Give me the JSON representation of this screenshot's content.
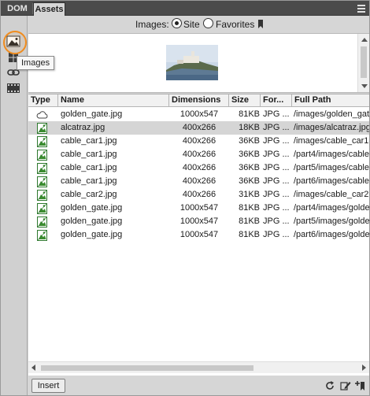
{
  "tabs": [
    {
      "label": "DOM",
      "active": false
    },
    {
      "label": "Assets",
      "active": true
    }
  ],
  "tooltip": {
    "text": "Images"
  },
  "left_toolbar": {
    "icons": [
      "images-icon",
      "colors-icon",
      "urls-icon",
      "media-icon"
    ],
    "highlight_color": "#f08c1e"
  },
  "source": {
    "label": "Images:",
    "options": [
      {
        "label": "Site",
        "selected": true
      },
      {
        "label": "Favorites",
        "selected": false
      }
    ]
  },
  "table": {
    "columns": [
      "Type",
      "Name",
      "Dimensions",
      "Size",
      "For...",
      "Full Path"
    ],
    "rows": [
      {
        "type": "cloud",
        "name": "golden_gate.jpg",
        "dimensions": "1000x547",
        "size": "81KB",
        "format": "JPG ...",
        "path": "/images/golden_gat",
        "selected": false
      },
      {
        "type": "image",
        "name": "alcatraz.jpg",
        "dimensions": "400x266",
        "size": "18KB",
        "format": "JPG ...",
        "path": "/images/alcatraz.jpg",
        "selected": true
      },
      {
        "type": "image",
        "name": "cable_car1.jpg",
        "dimensions": "400x266",
        "size": "36KB",
        "format": "JPG ...",
        "path": "/images/cable_car1.",
        "selected": false
      },
      {
        "type": "image",
        "name": "cable_car1.jpg",
        "dimensions": "400x266",
        "size": "36KB",
        "format": "JPG ...",
        "path": "/part4/images/cable",
        "selected": false
      },
      {
        "type": "image",
        "name": "cable_car1.jpg",
        "dimensions": "400x266",
        "size": "36KB",
        "format": "JPG ...",
        "path": "/part5/images/cable",
        "selected": false
      },
      {
        "type": "image",
        "name": "cable_car1.jpg",
        "dimensions": "400x266",
        "size": "36KB",
        "format": "JPG ...",
        "path": "/part6/images/cable",
        "selected": false
      },
      {
        "type": "image",
        "name": "cable_car2.jpg",
        "dimensions": "400x266",
        "size": "31KB",
        "format": "JPG ...",
        "path": "/images/cable_car2.",
        "selected": false
      },
      {
        "type": "image",
        "name": "golden_gate.jpg",
        "dimensions": "1000x547",
        "size": "81KB",
        "format": "JPG ...",
        "path": "/part4/images/golde",
        "selected": false
      },
      {
        "type": "image",
        "name": "golden_gate.jpg",
        "dimensions": "1000x547",
        "size": "81KB",
        "format": "JPG ...",
        "path": "/part5/images/golde",
        "selected": false
      },
      {
        "type": "image",
        "name": "golden_gate.jpg",
        "dimensions": "1000x547",
        "size": "81KB",
        "format": "JPG ...",
        "path": "/part6/images/golde",
        "selected": false
      }
    ]
  },
  "bottom": {
    "insert_label": "Insert",
    "icons": [
      "refresh-icon",
      "edit-icon",
      "add-to-favorites-icon"
    ]
  }
}
